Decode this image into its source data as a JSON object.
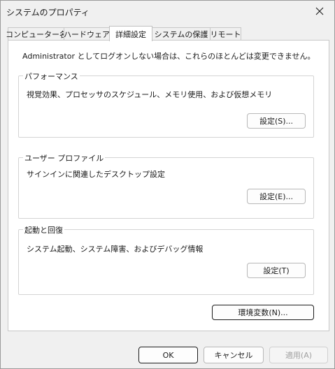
{
  "window": {
    "title": "システムのプロパティ"
  },
  "tabs": [
    {
      "label": "コンピューター名"
    },
    {
      "label": "ハードウェア"
    },
    {
      "label": "詳細設定",
      "active": true
    },
    {
      "label": "システムの保護"
    },
    {
      "label": "リモート"
    }
  ],
  "admin_notice": "Administrator としてログオンしない場合は、これらのほとんどは変更できません。",
  "performance": {
    "title": "パフォーマンス",
    "description": "視覚効果、プロセッサのスケジュール、メモリ使用、および仮想メモリ",
    "button": "設定(S)..."
  },
  "user_profile": {
    "title": "ユーザー プロファイル",
    "description": "サインインに関連したデスクトップ設定",
    "button": "設定(E)..."
  },
  "startup_recovery": {
    "title": "起動と回復",
    "description": "システム起動、システム障害、およびデバッグ情報",
    "button": "設定(T)"
  },
  "env_button": "環境変数(N)...",
  "footer": {
    "ok": "OK",
    "cancel": "キャンセル",
    "apply": "適用(A)"
  },
  "icons": {
    "close": "close-icon"
  }
}
